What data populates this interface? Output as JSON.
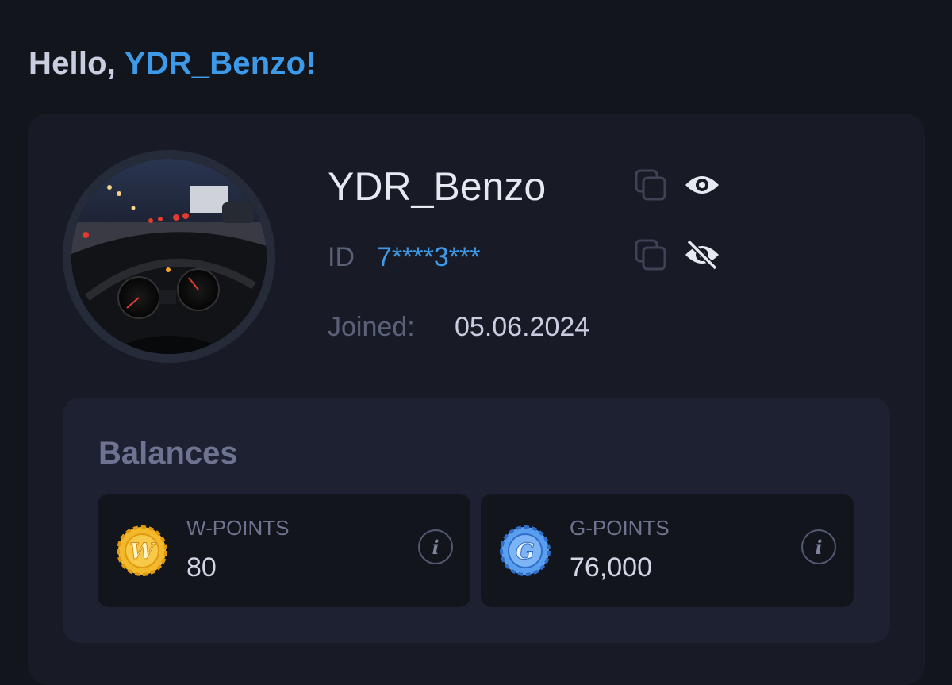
{
  "greeting": {
    "prefix": "Hello, ",
    "username": "YDR_Benzo!"
  },
  "profile": {
    "name": "YDR_Benzo",
    "id_label": "ID",
    "id_value": "7****3***",
    "joined_label": "Joined:",
    "joined_value": "05.06.2024",
    "avatar_description": "dashboard-at-night-photo"
  },
  "icons": {
    "name_copy": "copy-icon",
    "name_visibility": "eye-icon",
    "id_copy": "copy-icon",
    "id_visibility": "eye-off-icon",
    "info": "info-icon"
  },
  "balances": {
    "title": "Balances",
    "items": [
      {
        "label": "W-POINTS",
        "value": "80",
        "coin": "w-coin-icon",
        "coin_color": "#f2b92c"
      },
      {
        "label": "G-POINTS",
        "value": "76,000",
        "coin": "g-coin-icon",
        "coin_color": "#5a9ef0"
      }
    ],
    "info_glyph": "i"
  },
  "colors": {
    "background": "#13151c",
    "card": "#181b25",
    "balances_panel": "#1d2131",
    "accent": "#3d9ae8",
    "muted_text": "#5b6179"
  }
}
